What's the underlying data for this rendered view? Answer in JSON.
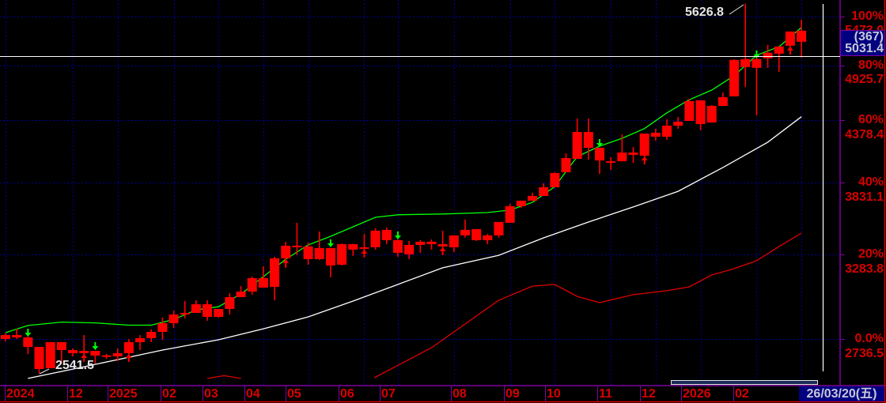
{
  "chart_data": {
    "type": "candlestick",
    "title": "",
    "y_scale": "log",
    "ylim": [
      2736.5,
      5473.0
    ],
    "y_ticks": [
      {
        "pct": "100%",
        "price": "5473.0",
        "value": 5473.0
      },
      {
        "pct": "80%",
        "price": "4925.7",
        "value": 4925.7
      },
      {
        "pct": "60%",
        "price": "4378.4",
        "value": 4378.4
      },
      {
        "pct": "40%",
        "price": "3831.1",
        "value": 3831.1
      },
      {
        "pct": "20%",
        "price": "3283.8",
        "value": 3283.8
      },
      {
        "pct": "0.0%",
        "price": "2736.5",
        "value": 2736.5
      }
    ],
    "x_labels": [
      "2024",
      "12",
      "2025",
      "02",
      "03",
      "04",
      "05",
      "06",
      "07",
      "08",
      "09",
      "10",
      "11",
      "12",
      "2026",
      "02"
    ],
    "month_start_bars": [
      1,
      7,
      11,
      16,
      20,
      24,
      28,
      33,
      36,
      41,
      46,
      50,
      55,
      59,
      63,
      68,
      72
    ],
    "candle_fields": [
      "open",
      "high",
      "low",
      "close"
    ],
    "candles": [
      [
        2736.5,
        2769.2,
        2722.6,
        2759.8
      ],
      [
        2745.8,
        2797.6,
        2736.5,
        2759.8
      ],
      [
        2690.4,
        2750.0,
        2649.6,
        2745.8
      ],
      [
        2565.4,
        2690.4,
        2541.5,
        2690.4
      ],
      [
        2569.8,
        2718.0,
        2569.8,
        2718.0
      ],
      [
        2672.2,
        2718.0,
        2600.5,
        2718.0
      ],
      [
        2654.1,
        2681.3,
        2636.1,
        2672.2
      ],
      [
        2654.1,
        2759.8,
        2627.2,
        2667.7
      ],
      [
        2640.6,
        2667.7,
        2596.1,
        2667.7
      ],
      [
        2640.6,
        2649.6,
        2622.7,
        2642.0
      ],
      [
        2636.1,
        2681.3,
        2609.4,
        2654.1
      ],
      [
        2654.1,
        2736.5,
        2609.4,
        2718.0
      ],
      [
        2718.0,
        2759.8,
        2672.2,
        2741.2
      ],
      [
        2741.2,
        2792.9,
        2718.0,
        2778.7
      ],
      [
        2778.7,
        2864.9,
        2731.9,
        2831.1
      ],
      [
        2831.1,
        2909.1,
        2802.4,
        2884.5
      ],
      [
        2884.5,
        2969.0,
        2860.1,
        2894.3
      ],
      [
        2894.3,
        2974.0,
        2894.3,
        2948.9
      ],
      [
        2869.8,
        2974.0,
        2845.6,
        2948.9
      ],
      [
        2869.8,
        2919.0,
        2865.0,
        2919.0
      ],
      [
        2919.0,
        3019.9,
        2884.5,
        2994.3
      ],
      [
        2994.3,
        3066.4,
        2994.3,
        3030.2
      ],
      [
        3030.2,
        3129.5,
        3009.6,
        3118.9
      ],
      [
        3056.0,
        3199.6,
        3056.0,
        3118.9
      ],
      [
        3061.2,
        3265.7,
        2974.0,
        3254.6
      ],
      [
        3254.6,
        3372.9,
        3188.8,
        3344.3
      ],
      [
        3338.7,
        3513.3,
        3276.8,
        3344.3
      ],
      [
        3249.1,
        3367.2,
        3210.5,
        3338.7
      ],
      [
        3249.1,
        3448.3,
        3243.6,
        3327.3
      ],
      [
        3205.0,
        3327.3,
        3124.2,
        3327.3
      ],
      [
        3210.5,
        3360.0,
        3205.0,
        3355.7
      ],
      [
        3316.0,
        3358.0,
        3271.2,
        3355.7
      ],
      [
        3321.7,
        3430.7,
        3293.5,
        3333.0
      ],
      [
        3333.0,
        3471.8,
        3316.0,
        3454.2
      ],
      [
        3384.4,
        3477.7,
        3355.7,
        3460.0
      ],
      [
        3293.5,
        3390.0,
        3265.7,
        3384.4
      ],
      [
        3282.4,
        3378.6,
        3249.1,
        3350.0
      ],
      [
        3350.0,
        3384.4,
        3293.5,
        3372.9
      ],
      [
        3355.7,
        3390.1,
        3316.0,
        3372.9
      ],
      [
        3338.7,
        3454.2,
        3299.2,
        3355.7
      ],
      [
        3333.0,
        3419.1,
        3299.2,
        3419.1
      ],
      [
        3419.1,
        3537.3,
        3401.7,
        3460.0
      ],
      [
        3384.4,
        3465.9,
        3378.6,
        3465.9
      ],
      [
        3384.4,
        3430.7,
        3355.7,
        3419.1
      ],
      [
        3419.1,
        3519.3,
        3401.7,
        3519.3
      ],
      [
        3513.3,
        3659.3,
        3513.3,
        3640.7
      ],
      [
        3640.7,
        3684.2,
        3628.4,
        3684.2
      ],
      [
        3684.2,
        3747.3,
        3684.2,
        3721.9
      ],
      [
        3721.9,
        3824.4,
        3721.9,
        3792.1
      ],
      [
        3792.1,
        3916.3,
        3792.1,
        3909.6
      ],
      [
        3916.3,
        4078.9,
        3916.3,
        4037.6
      ],
      [
        4030.7,
        4395.6,
        4030.7,
        4270.6
      ],
      [
        4127.7,
        4395.6,
        4023.9,
        4270.6
      ],
      [
        4017.1,
        4127.7,
        3903.0,
        4127.7
      ],
      [
        4003.5,
        4044.5,
        3936.4,
        4010.0
      ],
      [
        4010.3,
        4248.9,
        4010.3,
        4085.9
      ],
      [
        4065.1,
        4134.7,
        3996.7,
        4085.9
      ],
      [
        4058.2,
        4256.1,
        4003.5,
        4256.1
      ],
      [
        4227.3,
        4299.7,
        4191.5,
        4263.3
      ],
      [
        4227.3,
        4388.2,
        4198.7,
        4329.0
      ],
      [
        4329.0,
        4410.6,
        4299.7,
        4365.9
      ],
      [
        4373.3,
        4586.8,
        4373.3,
        4563.5
      ],
      [
        4343.7,
        4571.3,
        4285.1,
        4571.3
      ],
      [
        4358.5,
        4524.9,
        4358.5,
        4517.2
      ],
      [
        4517.2,
        4649.6,
        4517.2,
        4602.4
      ],
      [
        4610.3,
        4994.6,
        4610.3,
        4986.1
      ],
      [
        4910.6,
        5626.8,
        4705.1,
        4994.6
      ],
      [
        4902.3,
        5071.6,
        4425.6,
        4994.6
      ],
      [
        5003.1,
        5149.6,
        4902.3,
        5062.9
      ],
      [
        5054.3,
        5132.2,
        4860.8,
        5132.2
      ],
      [
        5140.9,
        5300.2,
        5071.6,
        5300.2
      ],
      [
        5184.7,
        5436.7,
        5011.6,
        5309.2
      ]
    ],
    "ma_green": [
      [
        1,
        2774
      ],
      [
        3,
        2817
      ],
      [
        6,
        2838
      ],
      [
        9,
        2833
      ],
      [
        12,
        2819
      ],
      [
        14,
        2819
      ],
      [
        16,
        2854
      ],
      [
        18,
        2913
      ],
      [
        20,
        2933
      ],
      [
        22,
        3014
      ],
      [
        24,
        3129
      ],
      [
        26,
        3249
      ],
      [
        28,
        3350
      ],
      [
        30,
        3412
      ],
      [
        32,
        3483
      ],
      [
        34,
        3555
      ],
      [
        36,
        3574
      ],
      [
        40,
        3580
      ],
      [
        44,
        3591
      ],
      [
        46,
        3611
      ],
      [
        48,
        3671
      ],
      [
        50,
        3798
      ],
      [
        52,
        4051
      ],
      [
        54,
        4142
      ],
      [
        56,
        4213
      ],
      [
        58,
        4302
      ],
      [
        60,
        4450
      ],
      [
        62,
        4577
      ],
      [
        64,
        4673
      ],
      [
        66,
        4820
      ],
      [
        68,
        5037
      ],
      [
        70,
        5129
      ],
      [
        72,
        5346
      ]
    ],
    "ma_white": [
      [
        3,
        2514
      ],
      [
        7,
        2565
      ],
      [
        11,
        2618
      ],
      [
        15,
        2672
      ],
      [
        20,
        2732
      ],
      [
        24,
        2797
      ],
      [
        28,
        2870
      ],
      [
        32,
        2969
      ],
      [
        36,
        3077
      ],
      [
        40,
        3189
      ],
      [
        45,
        3276
      ],
      [
        49,
        3401
      ],
      [
        53,
        3519
      ],
      [
        57,
        3635
      ],
      [
        61,
        3759
      ],
      [
        65,
        3957
      ],
      [
        69,
        4178
      ],
      [
        72,
        4413
      ]
    ],
    "ma_red": [
      [
        33.9,
        2518
      ],
      [
        39,
        2686
      ],
      [
        45,
        2974
      ],
      [
        48,
        3066
      ],
      [
        50,
        3077
      ],
      [
        52,
        2999
      ],
      [
        54,
        2959
      ],
      [
        57,
        3010
      ],
      [
        60,
        3036
      ],
      [
        62,
        3061
      ],
      [
        64,
        3140
      ],
      [
        66,
        3183
      ],
      [
        68,
        3238
      ],
      [
        70,
        3339
      ],
      [
        72,
        3436
      ]
    ],
    "ma_red_early": [
      [
        19,
        2514
      ],
      [
        20.5,
        2529
      ],
      [
        22,
        2514
      ]
    ],
    "sell_arrow_bars": [
      3,
      9,
      30,
      36,
      54,
      68
    ],
    "buy_arrow_bars": [
      8,
      12,
      26,
      33,
      40,
      58,
      71
    ],
    "high_label": "5626.8",
    "low_label": "2541.5",
    "crosshair": {
      "bars": "(367)",
      "price_label": "5031.4",
      "price": 5031.4
    },
    "date_label": "26/03/20(五)"
  },
  "colors": {
    "background": "#000000",
    "candle": "#ff0000",
    "ma_short": "#00ff00",
    "ma_long": "#ffffff",
    "ma_third": "#e00000",
    "grid": "#0000c8",
    "axis": "#8000a0",
    "axis_text": "#d80000",
    "box": "#000080"
  }
}
